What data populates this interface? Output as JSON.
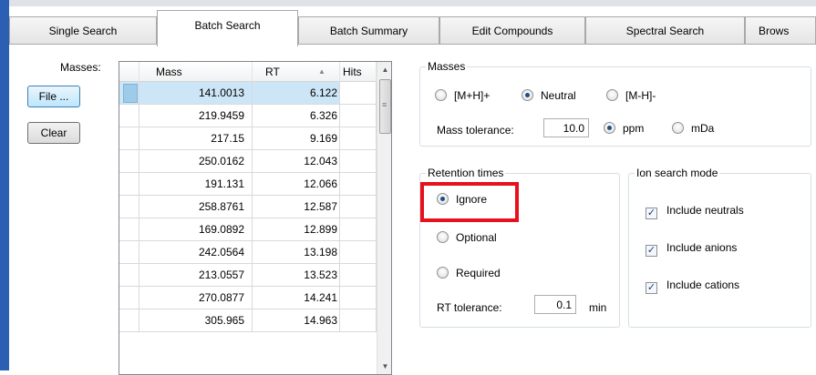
{
  "tabs": [
    {
      "label": "Single Search",
      "active": false
    },
    {
      "label": "Batch Search",
      "active": true
    },
    {
      "label": "Batch Summary",
      "active": false
    },
    {
      "label": "Edit Compounds",
      "active": false
    },
    {
      "label": "Spectral Search",
      "active": false
    },
    {
      "label": "Brows",
      "active": false
    }
  ],
  "left": {
    "masses_label": "Masses:",
    "file_button": "File ...",
    "clear_button": "Clear"
  },
  "grid": {
    "columns": [
      "Mass",
      "RT",
      "Hits"
    ],
    "sort_column": "RT",
    "selected_row": 0,
    "rows": [
      {
        "mass": "141.0013",
        "rt": "6.122",
        "hits": ""
      },
      {
        "mass": "219.9459",
        "rt": "6.326",
        "hits": ""
      },
      {
        "mass": "217.15",
        "rt": "9.169",
        "hits": ""
      },
      {
        "mass": "250.0162",
        "rt": "12.043",
        "hits": ""
      },
      {
        "mass": "191.131",
        "rt": "12.066",
        "hits": ""
      },
      {
        "mass": "258.8761",
        "rt": "12.587",
        "hits": ""
      },
      {
        "mass": "169.0892",
        "rt": "12.899",
        "hits": ""
      },
      {
        "mass": "242.0564",
        "rt": "13.198",
        "hits": ""
      },
      {
        "mass": "213.0557",
        "rt": "13.523",
        "hits": ""
      },
      {
        "mass": "270.0877",
        "rt": "14.241",
        "hits": ""
      },
      {
        "mass": "305.965",
        "rt": "14.963",
        "hits": ""
      }
    ]
  },
  "masses": {
    "title": "Masses",
    "ion_options": [
      {
        "label": "[M+H]+",
        "selected": false
      },
      {
        "label": "Neutral",
        "selected": true
      },
      {
        "label": "[M-H]-",
        "selected": false
      }
    ],
    "tolerance_label": "Mass tolerance:",
    "tolerance_value": "10.0",
    "unit_options": [
      {
        "label": "ppm",
        "selected": true
      },
      {
        "label": "mDa",
        "selected": false
      }
    ]
  },
  "retention": {
    "title": "Retention times",
    "options": [
      {
        "label": "Ignore",
        "selected": true
      },
      {
        "label": "Optional",
        "selected": false
      },
      {
        "label": "Required",
        "selected": false
      }
    ],
    "rt_tolerance_label": "RT tolerance:",
    "rt_tolerance_value": "0.1",
    "rt_unit": "min"
  },
  "ion_mode": {
    "title": "Ion search mode",
    "options": [
      {
        "label": "Include neutrals",
        "checked": true
      },
      {
        "label": "Include anions",
        "checked": true
      },
      {
        "label": "Include cations",
        "checked": true
      }
    ]
  },
  "colors": {
    "highlight": "#e8101d",
    "selection": "#cde6f7",
    "window_accent": "#2b5fb4"
  }
}
